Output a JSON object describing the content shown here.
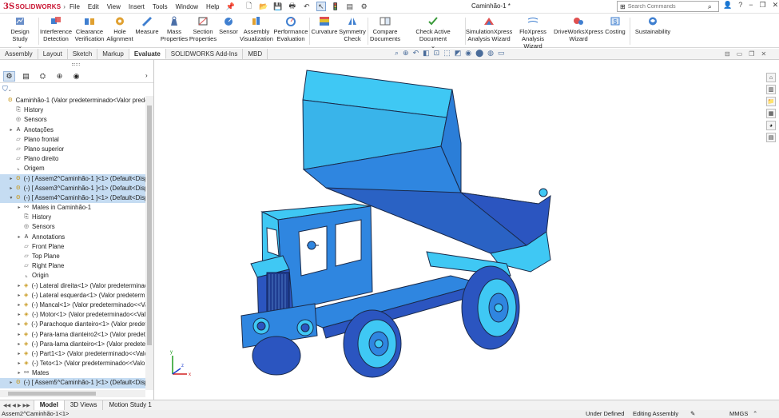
{
  "app": {
    "brand_prefix": "3S",
    "brand_name": "SOLIDWORKS",
    "document_title": "Caminhão-1 *"
  },
  "menu": [
    "File",
    "Edit",
    "View",
    "Insert",
    "Tools",
    "Window",
    "Help"
  ],
  "search": {
    "placeholder": "Search Commands"
  },
  "ribbon": [
    {
      "label": "Design Study",
      "icon": "design-study-icon"
    },
    {
      "label": "Interference Detection",
      "icon": "interference-icon"
    },
    {
      "label": "Clearance Verification",
      "icon": "clearance-icon"
    },
    {
      "label": "Hole Alignment",
      "icon": "hole-alignment-icon"
    },
    {
      "label": "Measure",
      "icon": "measure-icon"
    },
    {
      "label": "Mass Properties",
      "icon": "mass-properties-icon"
    },
    {
      "label": "Section Properties",
      "icon": "section-properties-icon"
    },
    {
      "label": "Sensor",
      "icon": "sensor-icon"
    },
    {
      "label": "Assembly Visualization",
      "icon": "assembly-visualization-icon"
    },
    {
      "label": "Performance Evaluation",
      "icon": "performance-icon"
    },
    {
      "label": "Curvature",
      "icon": "curvature-icon"
    },
    {
      "label": "Symmetry Check",
      "icon": "symmetry-icon"
    },
    {
      "label": "Compare Documents",
      "icon": "compare-icon"
    },
    {
      "label": "Check Active Document",
      "icon": "check-document-icon"
    },
    {
      "label": "SimulationXpress Analysis Wizard",
      "icon": "simulation-icon"
    },
    {
      "label": "FloXpress Analysis Wizard",
      "icon": "floxpress-icon"
    },
    {
      "label": "DriveWorksXpress Wizard",
      "icon": "driveworks-icon"
    },
    {
      "label": "Costing",
      "icon": "costing-icon"
    },
    {
      "label": "Sustainability",
      "icon": "sustainability-icon"
    }
  ],
  "command_tabs": [
    "Assembly",
    "Layout",
    "Sketch",
    "Markup",
    "Evaluate",
    "SOLIDWORKS Add-Ins",
    "MBD"
  ],
  "active_command_tab": "Evaluate",
  "tree": [
    {
      "text": "Caminhão-1  (Valor predeterminado<Valor prede",
      "level": 0,
      "toggle": "",
      "icon": "assembly-icon"
    },
    {
      "text": "History",
      "level": 1,
      "toggle": "",
      "icon": "history-icon"
    },
    {
      "text": "Sensors",
      "level": 1,
      "toggle": "",
      "icon": "sensor-icon"
    },
    {
      "text": "Anotações",
      "level": 1,
      "toggle": "▸",
      "icon": "annotation-icon"
    },
    {
      "text": "Plano frontal",
      "level": 1,
      "toggle": "",
      "icon": "plane-icon"
    },
    {
      "text": "Plano superior",
      "level": 1,
      "toggle": "",
      "icon": "plane-icon"
    },
    {
      "text": "Plano direito",
      "level": 1,
      "toggle": "",
      "icon": "plane-icon"
    },
    {
      "text": "Origem",
      "level": 1,
      "toggle": "",
      "icon": "origin-icon"
    },
    {
      "text": "(-) [ Assem2^Caminhão-1 ]<1> (Default<Disp",
      "level": 1,
      "toggle": "▸",
      "icon": "subassembly-icon",
      "selected": true
    },
    {
      "text": "(-) [ Assem3^Caminhão-1 ]<1> (Default<Disp",
      "level": 1,
      "toggle": "▸",
      "icon": "subassembly-icon",
      "selected": true
    },
    {
      "text": "(-) [ Assem4^Caminhão-1 ]<1> (Default<Disp",
      "level": 1,
      "toggle": "▾",
      "icon": "subassembly-icon",
      "selected": true
    },
    {
      "text": "Mates in Caminhão-1",
      "level": 2,
      "toggle": "▸",
      "icon": "mates-icon"
    },
    {
      "text": "History",
      "level": 2,
      "toggle": "",
      "icon": "history-icon"
    },
    {
      "text": "Sensors",
      "level": 2,
      "toggle": "",
      "icon": "sensor-icon"
    },
    {
      "text": "Annotations",
      "level": 2,
      "toggle": "▸",
      "icon": "annotation-icon"
    },
    {
      "text": "Front Plane",
      "level": 2,
      "toggle": "",
      "icon": "plane-icon"
    },
    {
      "text": "Top Plane",
      "level": 2,
      "toggle": "",
      "icon": "plane-icon"
    },
    {
      "text": "Right Plane",
      "level": 2,
      "toggle": "",
      "icon": "plane-icon"
    },
    {
      "text": "Origin",
      "level": 2,
      "toggle": "",
      "icon": "origin-icon"
    },
    {
      "text": "(-) Lateral direita<1> (Valor predeterminac",
      "level": 2,
      "toggle": "▸",
      "icon": "part-icon"
    },
    {
      "text": "(-) Lateral esquerda<1> (Valor predetermir",
      "level": 2,
      "toggle": "▸",
      "icon": "part-icon"
    },
    {
      "text": "(-) Mancal<1> (Valor predeterminado<<Va",
      "level": 2,
      "toggle": "▸",
      "icon": "part-icon"
    },
    {
      "text": "(-) Motor<1> (Valor predeterminado<<Val",
      "level": 2,
      "toggle": "▸",
      "icon": "part-icon"
    },
    {
      "text": "(-) Parachoque dianteiro<1> (Valor predete",
      "level": 2,
      "toggle": "▸",
      "icon": "part-icon"
    },
    {
      "text": "(-) Para-lama dianteiro2<1> (Valor predete",
      "level": 2,
      "toggle": "▸",
      "icon": "part-icon"
    },
    {
      "text": "(-) Para-lama dianteiro<1> (Valor predeter",
      "level": 2,
      "toggle": "▸",
      "icon": "part-icon"
    },
    {
      "text": "(-) Part1<1> (Valor predeterminado<<Valo",
      "level": 2,
      "toggle": "▸",
      "icon": "part-icon"
    },
    {
      "text": "(-) Teto<1> (Valor predeterminado<<Valo",
      "level": 2,
      "toggle": "▸",
      "icon": "part-icon"
    },
    {
      "text": "Mates",
      "level": 2,
      "toggle": "▸",
      "icon": "mates-icon"
    },
    {
      "text": "(-) [ Assem5^Caminhão-1 ]<1> (Default<Disp",
      "level": 1,
      "toggle": "▸",
      "icon": "subassembly-icon",
      "selected": true
    }
  ],
  "bottom_tabs": [
    "Model",
    "3D Views",
    "Motion Study 1"
  ],
  "active_bottom_tab": "Model",
  "status": {
    "selection": "Assem2^Caminhão-1<1>",
    "definition": "Under Defined",
    "mode": "Editing Assembly",
    "units": "MMGS"
  },
  "colors": {
    "model_light": "#3fc8f4",
    "model_mid": "#2f86e0",
    "model_dark": "#2b55c0",
    "selection": "#c5dcf2"
  }
}
